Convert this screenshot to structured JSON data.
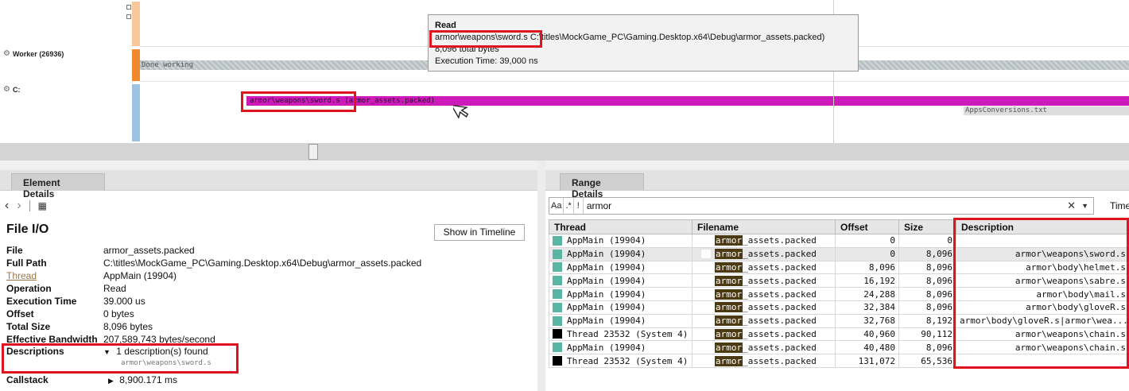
{
  "timeline": {
    "lanes": [
      {
        "label": "Worker (26936)",
        "bar_text": "Done working",
        "strip_color": "#f08a2c"
      },
      {
        "label": "C:",
        "bar_text": "armor\\weapons\\sword.s (armor_assets.packed)",
        "bar_color": "#cc1bb8",
        "strip_color": "#9cc2e4"
      }
    ],
    "top_strip_color": "#f6c89a",
    "secondary_bar_text": "AppsConversions.txt",
    "tooltip": {
      "title": "Read",
      "path_highlight": "armor\\weapons\\sword.s",
      "path_rest": "C:\\titles\\MockGame_PC\\Gaming.Desktop.x64\\Debug\\armor_assets.packed)",
      "bytes": "8,096 total bytes",
      "exec_time": "Execution Time: 39,000 ns"
    }
  },
  "element_details": {
    "tab": "Element Details",
    "section_title": "File I/O",
    "show_in_timeline": "Show in Timeline",
    "fields": [
      {
        "key": "File",
        "value": "armor_assets.packed"
      },
      {
        "key": "Full Path",
        "value": "C:\\titles\\MockGame_PC\\Gaming.Desktop.x64\\Debug\\armor_assets.packed"
      },
      {
        "key": "Thread",
        "value": "AppMain (19904)"
      },
      {
        "key": "Operation",
        "value": "Read"
      },
      {
        "key": "Execution Time",
        "value": "39.000 us"
      },
      {
        "key": "Offset",
        "value": "0 bytes"
      },
      {
        "key": "Total Size",
        "value": "8,096 bytes"
      },
      {
        "key": "Effective Bandwidth",
        "value": "207,589,743 bytes/second"
      }
    ],
    "descriptions": {
      "key": "Descriptions",
      "summary": "1 description(s) found",
      "item": "armor\\weapons\\sword.s"
    },
    "callstack": {
      "key": "Callstack",
      "value": "8,900.171 ms"
    }
  },
  "range_details": {
    "tab": "Range Details",
    "search": {
      "toggles": [
        "Aa",
        ".*",
        "!"
      ],
      "value": "armor"
    },
    "time_label": "Time",
    "columns": [
      "Thread",
      "Filename",
      "Offset",
      "Size",
      "Description"
    ],
    "highlight_term": "armor",
    "filename_suffix": "_assets.packed",
    "rows": [
      {
        "thread": "AppMain (19904)",
        "color": "#5ab5a4",
        "offset": "0",
        "size": "0",
        "description": ""
      },
      {
        "thread": "AppMain (19904)",
        "color": "#5ab5a4",
        "offset": "0",
        "size": "8,096",
        "description": "armor\\weapons\\sword.s",
        "selected": true
      },
      {
        "thread": "AppMain (19904)",
        "color": "#5ab5a4",
        "offset": "8,096",
        "size": "8,096",
        "description": "armor\\body\\helmet.s"
      },
      {
        "thread": "AppMain (19904)",
        "color": "#5ab5a4",
        "offset": "16,192",
        "size": "8,096",
        "description": "armor\\weapons\\sabre.s"
      },
      {
        "thread": "AppMain (19904)",
        "color": "#5ab5a4",
        "offset": "24,288",
        "size": "8,096",
        "description": "armor\\body\\mail.s"
      },
      {
        "thread": "AppMain (19904)",
        "color": "#5ab5a4",
        "offset": "32,384",
        "size": "8,096",
        "description": "armor\\body\\gloveR.s"
      },
      {
        "thread": "AppMain (19904)",
        "color": "#5ab5a4",
        "offset": "32,768",
        "size": "8,192",
        "description": "armor\\body\\gloveR.s|armor\\wea..."
      },
      {
        "thread": "Thread 23532 (System 4)",
        "color": "#000000",
        "offset": "40,960",
        "size": "90,112",
        "description": "armor\\weapons\\chain.s"
      },
      {
        "thread": "AppMain (19904)",
        "color": "#5ab5a4",
        "offset": "40,480",
        "size": "8,096",
        "description": "armor\\weapons\\chain.s"
      },
      {
        "thread": "Thread 23532 (System 4)",
        "color": "#000000",
        "offset": "131,072",
        "size": "65,536",
        "description": ""
      }
    ]
  },
  "icons": {
    "back": "chevron-left-icon",
    "forward": "chevron-right-icon",
    "settings": "gear-icon",
    "clear": "close-icon",
    "dropdown": "caret-down-icon"
  },
  "colors": {
    "annotation_red": "#e0141e",
    "highlight_bg": "#4b3a12"
  }
}
